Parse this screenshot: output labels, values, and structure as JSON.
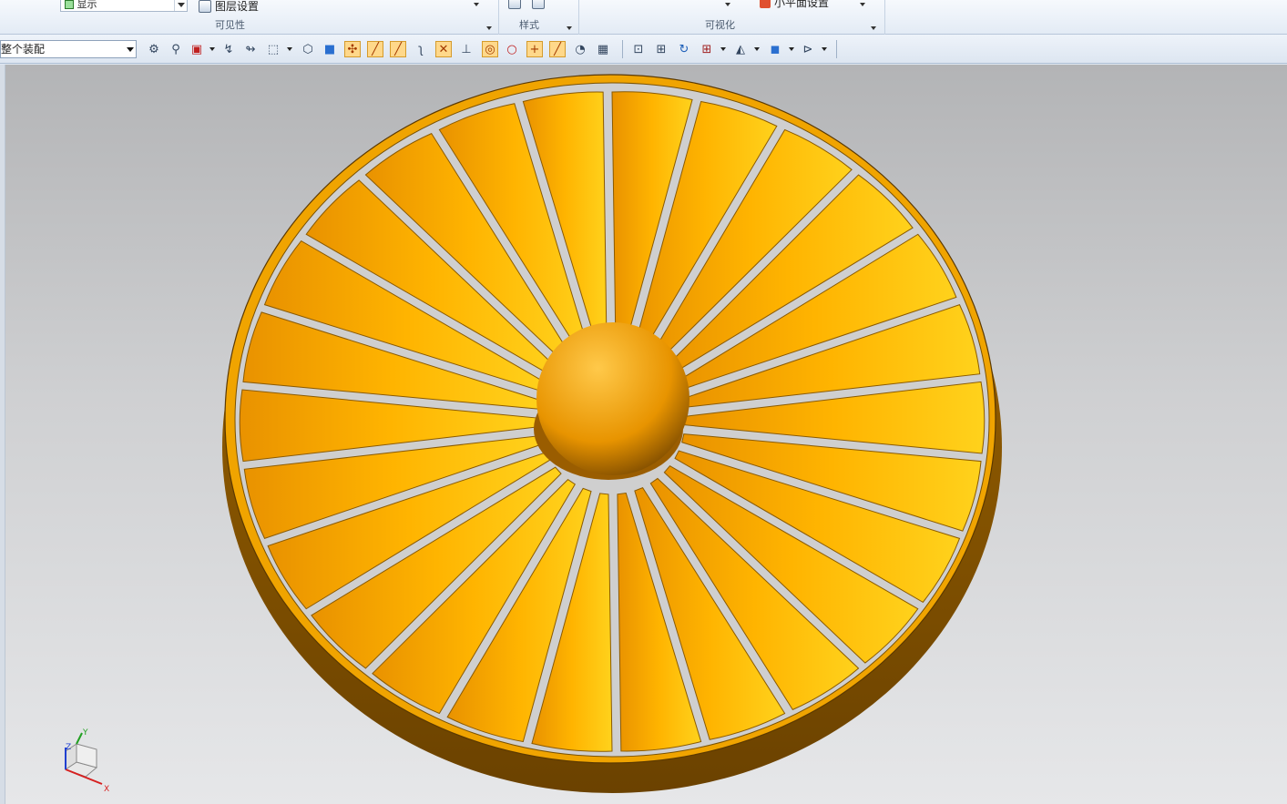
{
  "ribbon": {
    "show_combo": "显示",
    "layer_settings": "图层设置",
    "visibility_label": "可见性",
    "style_label": "样式",
    "visualization_label": "可视化",
    "background_settings": "小平面设置"
  },
  "toolbar": {
    "assembly_filter": "整个装配",
    "icons": [
      "snap-icon",
      "snap-point-icon",
      "select-icon",
      "arrow-icon",
      "select-rect-icon",
      "view-icon",
      "shaded-icon",
      "end-point-icon",
      "mid-point-icon",
      "control-point-icon",
      "curve-icon",
      "intersection-icon",
      "point-on-curve-icon",
      "center-point-icon",
      "quadrant-icon",
      "existing-point-icon",
      "point-on-face-icon",
      "fit-icon",
      "zoom-icon",
      "rotate-icon",
      "layout-icon",
      "render-icon",
      "cube-icon",
      "wcs-icon"
    ]
  },
  "scene": {
    "part_color": "#f5a600",
    "dark_color": "#7a4a00",
    "blade_count": 26
  },
  "triad": {
    "x_label": "X",
    "y_label": "Y",
    "z_label": "Z",
    "x_color": "#d62020",
    "y_color": "#22a022",
    "z_color": "#2040d0"
  }
}
